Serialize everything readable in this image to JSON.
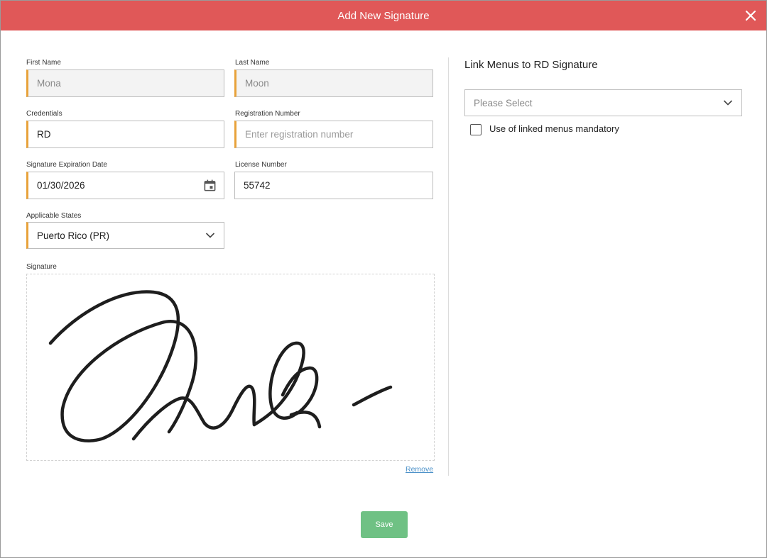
{
  "header": {
    "title": "Add New Signature"
  },
  "form": {
    "first_name": {
      "label": "First Name",
      "value": "Mona"
    },
    "last_name": {
      "label": "Last Name",
      "value": "Moon"
    },
    "credentials": {
      "label": "Credentials",
      "value": "RD"
    },
    "registration_number": {
      "label": "Registration Number",
      "value": "",
      "placeholder": "Enter registration number"
    },
    "signature_expiration_date": {
      "label": "Signature Expiration Date",
      "value": "01/30/2026"
    },
    "license_number": {
      "label": "License Number",
      "value": "55742"
    },
    "applicable_states": {
      "label": "Applicable States",
      "value": "Puerto Rico (PR)"
    },
    "signature": {
      "label": "Signature",
      "remove_label": "Remove"
    }
  },
  "link_menus": {
    "title": "Link Menus to RD Signature",
    "select_placeholder": "Please Select",
    "mandatory_label": "Use of linked menus mandatory",
    "mandatory_checked": false
  },
  "footer": {
    "save_label": "Save"
  },
  "colors": {
    "header_bg": "#e05858",
    "required_accent": "#e8a23a",
    "save_button": "#6fc184",
    "link": "#4a90c8"
  }
}
